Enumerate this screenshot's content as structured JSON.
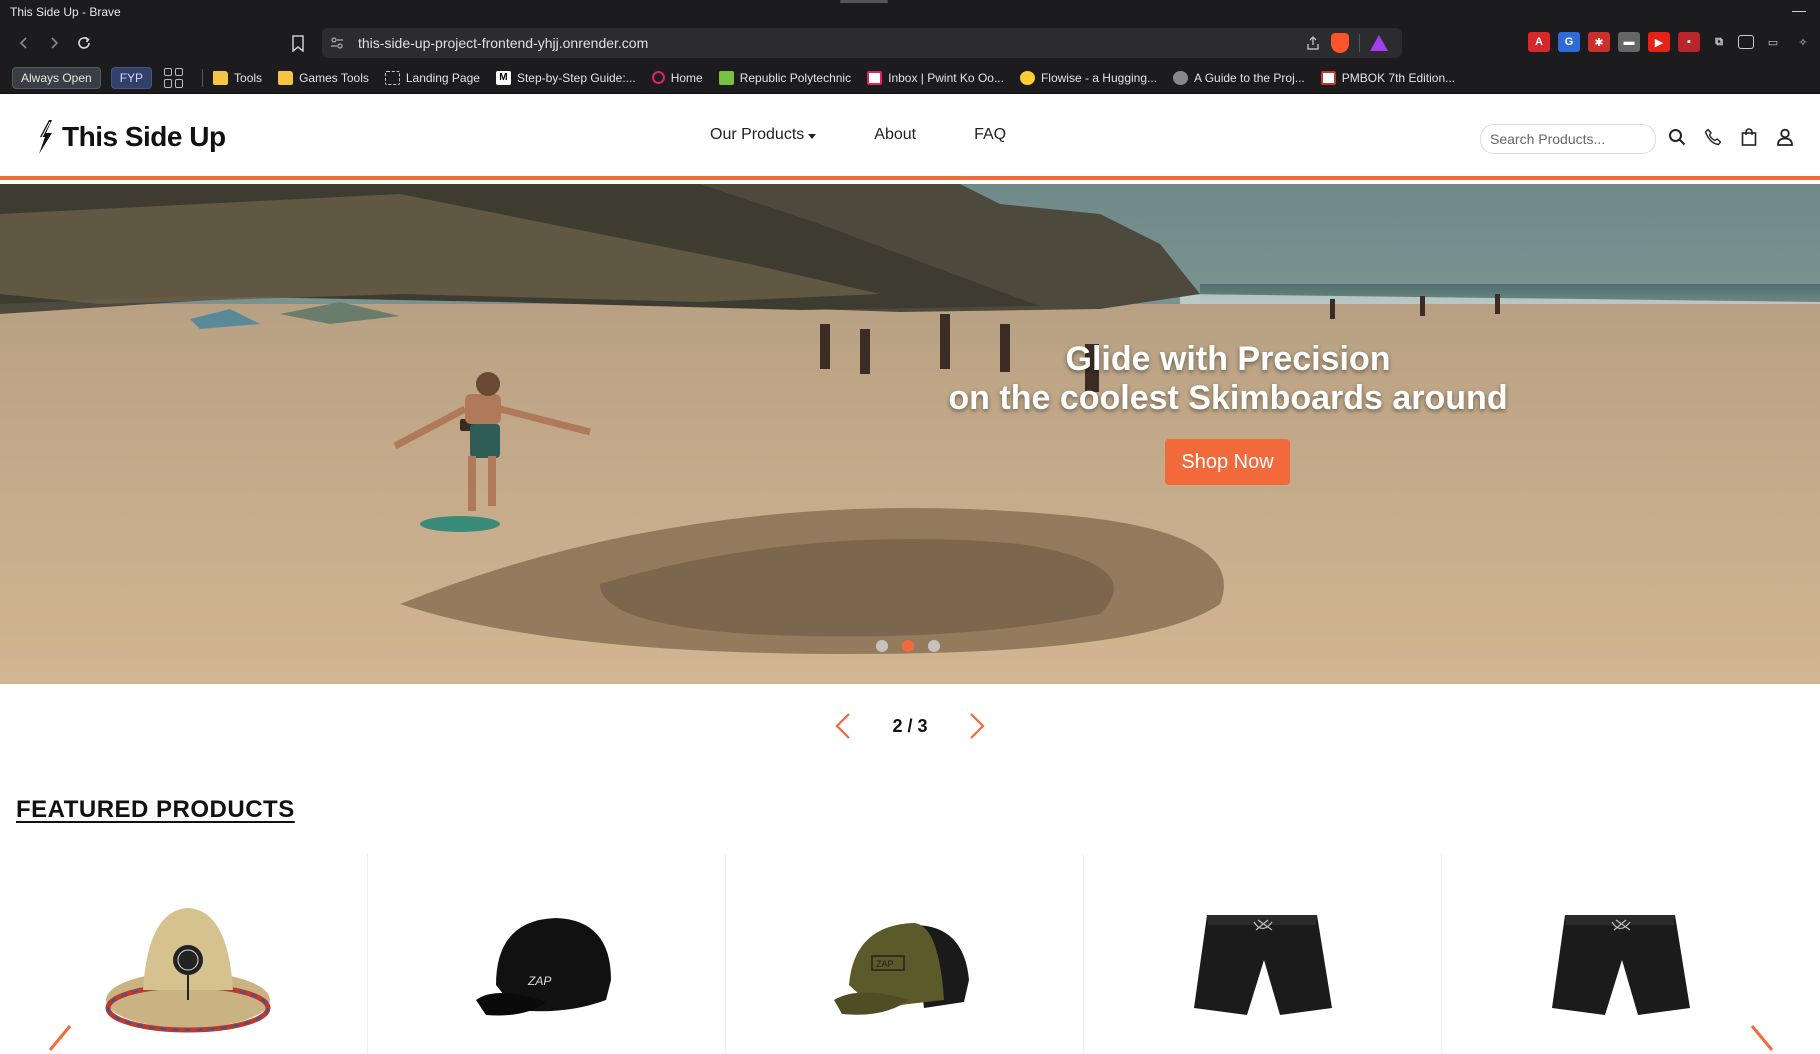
{
  "window": {
    "title": "This Side Up - Brave"
  },
  "browser": {
    "url": "this-side-up-project-frontend-yhjj.onrender.com",
    "bookmarks_bar": {
      "pills": [
        "Always Open",
        "FYP"
      ],
      "items": [
        {
          "label": "Tools",
          "icon": "folder-icon",
          "color": "#f4c542"
        },
        {
          "label": "Games Tools",
          "icon": "folder-icon",
          "color": "#f4c542"
        },
        {
          "label": "Landing Page",
          "icon": "grid-icon",
          "color": "#cccccc"
        },
        {
          "label": "Step-by-Step Guide:...",
          "icon": "medium-icon",
          "color": "#ffffff"
        },
        {
          "label": "Home",
          "icon": "opera-icon",
          "color": "#e0245e"
        },
        {
          "label": "Republic Polytechnic",
          "icon": "rp-icon",
          "color": "#79c043"
        },
        {
          "label": "Inbox | Pwint Ko Oo...",
          "icon": "mail-icon",
          "color": "#e0245e"
        },
        {
          "label": "Flowise - a Hugging...",
          "icon": "hugging-face-icon",
          "color": "#ffcc33"
        },
        {
          "label": "A Guide to the Proj...",
          "icon": "globe-icon",
          "color": "#aaaaaa"
        },
        {
          "label": "PMBOK 7th Edition...",
          "icon": "pmbok-icon",
          "color": "#c0392b"
        }
      ]
    }
  },
  "site": {
    "logo_text": "This Side Up",
    "nav": {
      "products": "Our Products",
      "about": "About",
      "faq": "FAQ"
    },
    "search_placeholder": "Search Products...",
    "accent_color": "#f26a3b"
  },
  "hero": {
    "title": "Glide with Precision",
    "subtitle": "on the coolest Skimboards around",
    "cta": "Shop Now",
    "slide_count": "2 / 3",
    "active_slide": 2,
    "total_slides": 3
  },
  "featured": {
    "heading": "FEATURED PRODUCTS",
    "products": [
      {
        "image": "straw-hat"
      },
      {
        "image": "black-cap"
      },
      {
        "image": "olive-trucker-cap"
      },
      {
        "image": "black-shorts"
      },
      {
        "image": "black-shorts"
      }
    ]
  }
}
